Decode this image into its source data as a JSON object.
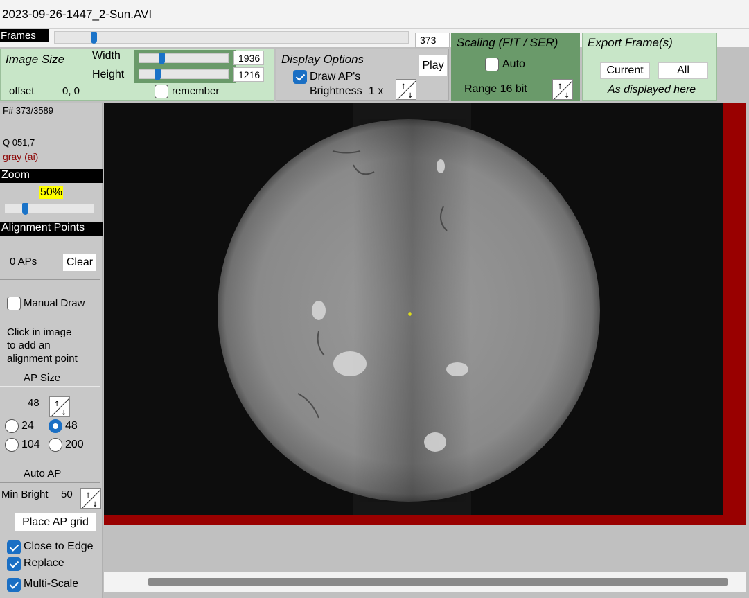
{
  "window": {
    "title": "2023-09-26-1447_2-Sun.AVI"
  },
  "frames": {
    "label": "Frames",
    "value": "373",
    "position_fraction": 0.1
  },
  "image_size": {
    "title": "Image Size",
    "width_label": "Width",
    "width_value": "1936",
    "height_label": "Height",
    "height_value": "1216",
    "offset_label": "offset",
    "offset_value": "0, 0",
    "remember_label": "remember",
    "remember_checked": false
  },
  "display_options": {
    "title": "Display Options",
    "draw_aps_label": "Draw AP's",
    "draw_aps_checked": true,
    "brightness_label": "Brightness",
    "brightness_value": "1 x",
    "play_label": "Play"
  },
  "scaling": {
    "title": "Scaling (FIT / SER)",
    "auto_label": "Auto",
    "auto_checked": false,
    "range_label": "Range 16 bit"
  },
  "export": {
    "title": "Export Frame(s)",
    "current_label": "Current",
    "all_label": "All",
    "note": "As displayed here"
  },
  "frame_info": {
    "frame": "F# 373/3589",
    "quality": "Q  051,7",
    "mode": "gray (ai)"
  },
  "zoom": {
    "header": "Zoom",
    "value": "50%"
  },
  "alignment_points": {
    "header": "Alignment Points",
    "count": "0 APs",
    "clear_label": "Clear",
    "manual_draw_label": "Manual Draw",
    "manual_draw_checked": false,
    "hint_line1": "Click in image",
    "hint_line2": "to add an",
    "hint_line3": "alignment point",
    "ap_size_header": "AP Size",
    "ap_size_value": "48",
    "sizes": [
      "24",
      "48",
      "104",
      "200"
    ],
    "selected_size": "48",
    "auto_ap_header": "Auto AP",
    "min_bright_label": "Min Bright",
    "min_bright_value": "50",
    "place_grid_label": "Place AP grid",
    "close_to_edge_label": "Close to Edge",
    "replace_label": "Replace",
    "multi_scale_label": "Multi-Scale"
  },
  "colors": {
    "accent": "#1a6fc4",
    "panel_green": "#c8e6c8",
    "panel_dark_green": "#6a9a6a",
    "frame_border": "#990000",
    "zoom_highlight": "#ffff00"
  }
}
